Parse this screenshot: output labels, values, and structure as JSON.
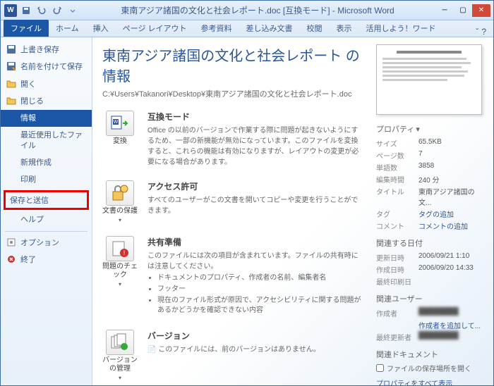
{
  "titlebar": {
    "app_icon": "W",
    "title": "東南アジア諸国の文化と社会レポート.doc [互換モード] - Microsoft Word"
  },
  "tabs": {
    "file": "ファイル",
    "home": "ホーム",
    "insert": "挿入",
    "page_layout": "ページ レイアウト",
    "references": "参考資料",
    "mailings": "差し込み文書",
    "review": "校閲",
    "view": "表示",
    "addins": "活用しよう！ワード"
  },
  "sidebar": {
    "save": "上書き保存",
    "save_as": "名前を付けて保存",
    "open": "開く",
    "close": "閉じる",
    "info": "情報",
    "recent": "最近使用したファイル",
    "new": "新規作成",
    "print": "印刷",
    "save_send": "保存と送信",
    "help": "ヘルプ",
    "options": "オプション",
    "exit": "終了"
  },
  "main": {
    "title": "東南アジア諸国の文化と社会レポート の情報",
    "path": "C:¥Users¥Takanori¥Desktop¥東南アジア諸国の文化と社会レポート.doc",
    "compat": {
      "btn": "変換",
      "head": "互換モード",
      "text": "Office の以前のバージョンで作業する際に問題が起きないようにするため、一部の新機能が無効になっています。このファイルを変換すると、これらの機能は有効になりますが、レイアウトの変更が必要になる場合があります。"
    },
    "protect": {
      "btn": "文書の保護",
      "head": "アクセス許可",
      "text": "すべてのユーザーがこの文書を開いてコピーや変更を行うことができます。"
    },
    "check": {
      "btn": "問題のチェック",
      "head": "共有準備",
      "text": "このファイルには次の項目が含まれています。ファイルの共有時には注意してください。",
      "items": [
        "ドキュメントのプロパティ、作成者の名前、編集者名",
        "フッター",
        "現在のファイル形式が原因で、アクセシビリティに関する問題があるかどうかを確認できない内容"
      ]
    },
    "versions": {
      "btn": "バージョンの管理",
      "head": "バージョン",
      "text": "このファイルには、前のバージョンはありません。"
    }
  },
  "props": {
    "header": "プロパティ",
    "size_l": "サイズ",
    "size_v": "65.5KB",
    "pages_l": "ページ数",
    "pages_v": "7",
    "words_l": "単語数",
    "words_v": "3858",
    "edit_l": "編集時間",
    "edit_v": "240 分",
    "title_l": "タイトル",
    "title_v": "東南アジア諸国の文...",
    "tags_l": "タグ",
    "tags_v": "タグの追加",
    "comments_l": "コメント",
    "comments_v": "コメントの追加",
    "dates_header": "関連する日付",
    "modified_l": "更新日時",
    "modified_v": "2006/09/21 1:10",
    "created_l": "作成日時",
    "created_v": "2006/09/20 14:33",
    "printed_l": "最終印刷日",
    "printed_v": "",
    "users_header": "関連ユーザー",
    "author_l": "作成者",
    "author_v": "████████",
    "author_add": "作成者を追加して...",
    "lastmod_l": "最終更新者",
    "lastmod_v": "████████",
    "docs_header": "関連ドキュメント",
    "open_loc": "ファイルの保存場所を開く",
    "show_all": "プロパティをすべて表示"
  }
}
